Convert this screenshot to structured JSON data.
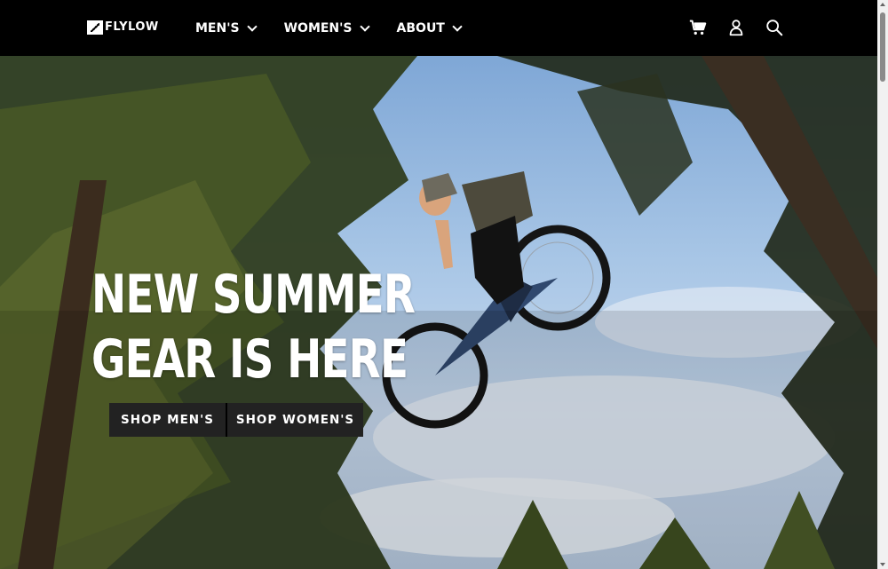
{
  "brand": {
    "name": "FLYLOW"
  },
  "nav": {
    "items": [
      {
        "label": "MEN'S"
      },
      {
        "label": "WOMEN'S"
      },
      {
        "label": "ABOUT"
      }
    ]
  },
  "header_icons": [
    "cart-icon",
    "account-icon",
    "search-icon"
  ],
  "hero": {
    "headline_line1": "NEW SUMMER",
    "headline_line2": "GEAR IS HERE",
    "cta_men": "SHOP MEN'S",
    "cta_women": "SHOP WOMEN'S"
  },
  "colors": {
    "header_bg": "#000000",
    "cta_bg": "#222222",
    "text": "#ffffff"
  }
}
